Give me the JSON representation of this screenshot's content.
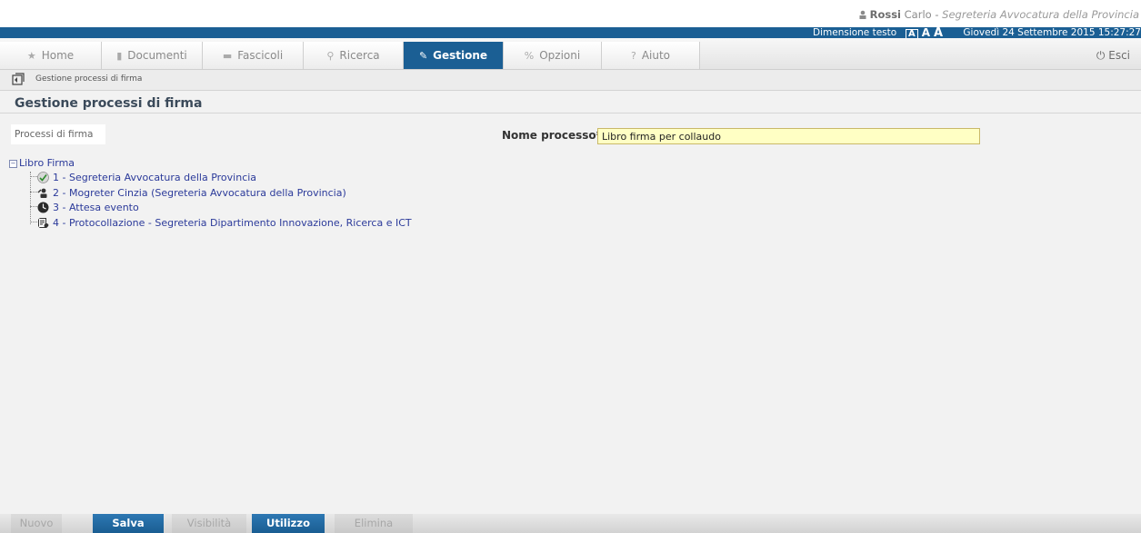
{
  "user": {
    "surname": "Rossi",
    "name": "Carlo",
    "separator": " - ",
    "office": "Segreteria Avvocatura della Provincia"
  },
  "infobar": {
    "text_size_label": "Dimensione testo",
    "size_small": "A",
    "size_medium": "A",
    "size_large": "A",
    "datetime": "Giovedì 24 Settembre 2015 15:27:27"
  },
  "nav": {
    "tabs": [
      {
        "label": "Home",
        "icon": "home-icon"
      },
      {
        "label": "Documenti",
        "icon": "document-icon"
      },
      {
        "label": "Fascicoli",
        "icon": "folder-icon"
      },
      {
        "label": "Ricerca",
        "icon": "search-icon"
      },
      {
        "label": "Gestione",
        "icon": "pencil-icon"
      },
      {
        "label": "Opzioni",
        "icon": "options-icon"
      },
      {
        "label": "Aiuto",
        "icon": "help-icon"
      }
    ],
    "exit_label": "Esci"
  },
  "breadcrumb": {
    "text": "Gestione processi di firma"
  },
  "page": {
    "title": "Gestione processi di firma"
  },
  "panel": {
    "tab_label": "Processi di firma"
  },
  "form": {
    "name_label": "Nome processo*",
    "name_value": "Libro firma per collaudo"
  },
  "tree": {
    "root": {
      "label": "Libro Firma",
      "expander": "−"
    },
    "nodes": [
      {
        "label": "1 - Segreteria Avvocatura della Provincia",
        "icon": "signature-check-icon"
      },
      {
        "label": "2 - Mogreter  Cinzia (Segreteria Avvocatura della Provincia)",
        "icon": "user-signature-icon"
      },
      {
        "label": "3 - Attesa evento",
        "icon": "clock-icon"
      },
      {
        "label": "4 - Protocollazione - Segreteria Dipartimento Innovazione, Ricerca e ICT",
        "icon": "protocol-icon"
      }
    ]
  },
  "actions": {
    "nuovo": "Nuovo",
    "salva": "Salva",
    "visibilita": "Visibilità",
    "utilizzo": "Utilizzo",
    "elimina": "Elimina"
  },
  "colors": {
    "brand_blue": "#1b5f94",
    "input_highlight": "#ffffc4",
    "tree_link": "#2b3a9a"
  }
}
